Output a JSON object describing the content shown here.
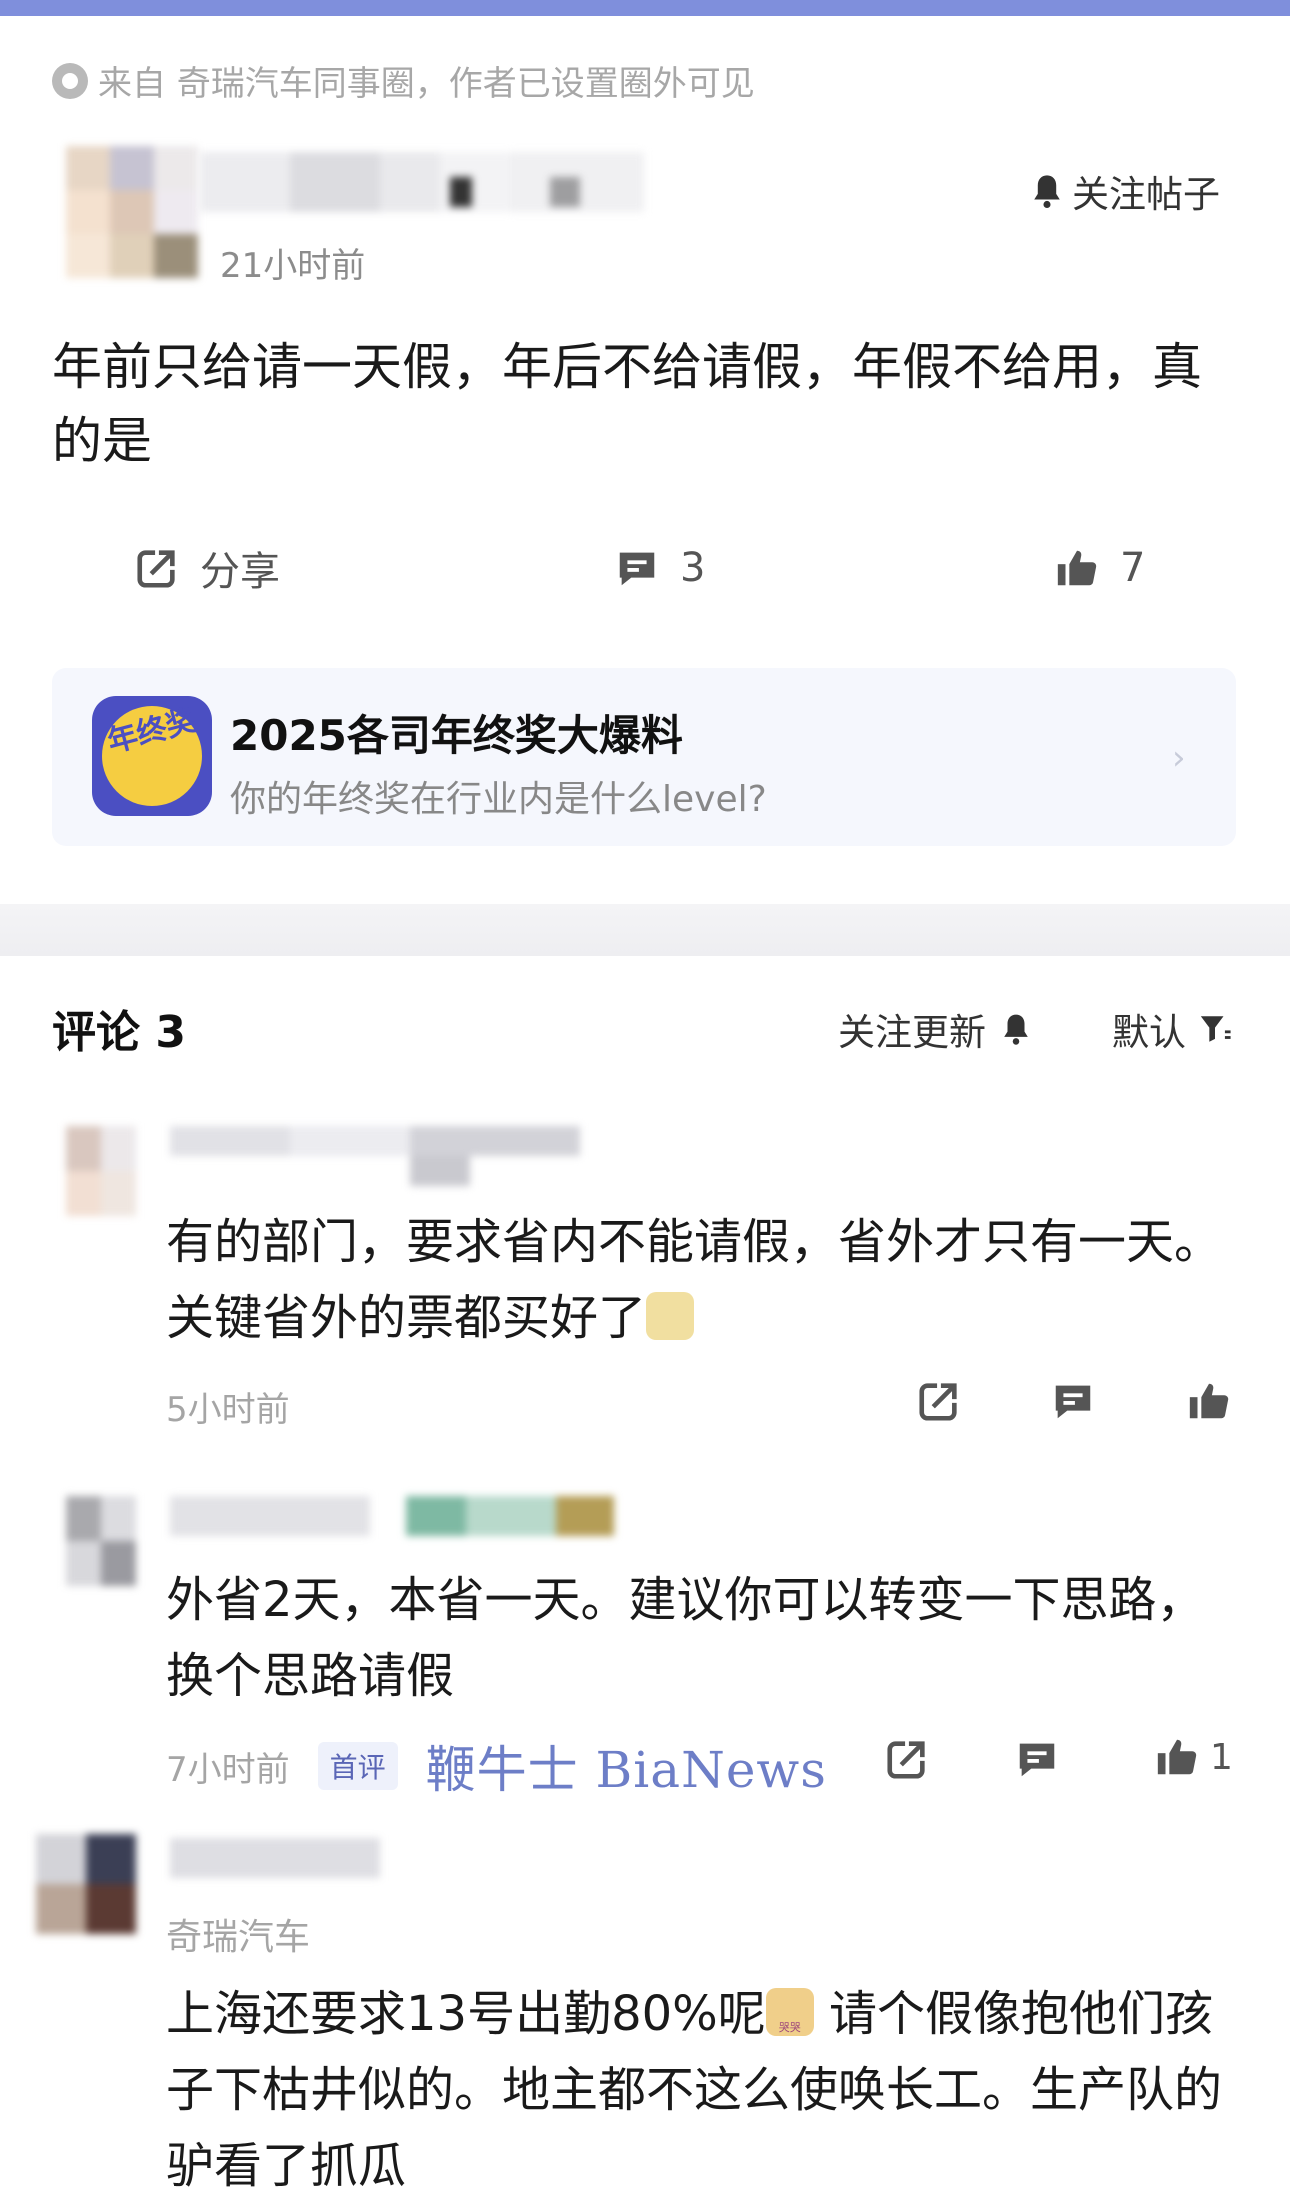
{
  "post": {
    "source_text": "来自 奇瑞汽车同事圈，作者已设置圈外可见",
    "time": "21小时前",
    "follow_label": "关注帖子",
    "body": "年前只给请一天假，年后不给请假，年假不给用，真的是",
    "share_label": "分享",
    "comment_count": "3",
    "like_count": "7"
  },
  "banner": {
    "logo_text": "年终奖",
    "title": "2025各司年终奖大爆料",
    "subtitle": "你的年终奖在行业内是什么level?"
  },
  "comments_header": {
    "title": "评论 3",
    "follow_updates": "关注更新",
    "sort_label": "默认"
  },
  "comments": [
    {
      "text": "有的部门，要求省内不能请假，省外才只有一天。关键省外的票都买好了",
      "time": "5小时前"
    },
    {
      "text": "外省2天，本省一天。建议你可以转变一下思路，换个思路请假",
      "time": "7小时前",
      "badge": "首评",
      "like_count": "1"
    },
    {
      "company": "奇瑞汽车",
      "text_part1": "上海还要求13号出勤80%呢",
      "text_part2": "请个假像抱他们孩子下枯井似的。地主都不这么使唤长工。生产队的驴看了抓瓜",
      "emoji_label": "哭哭"
    }
  ],
  "watermark": "鞭牛士 BiaNews",
  "colors": {
    "accent": "#7f8fdc",
    "watermark": "#6d7ec7",
    "banner_bg": "#f5f7fd"
  },
  "icons": [
    "eye-icon",
    "bell-icon",
    "share-icon",
    "comment-icon",
    "thumbs-up-icon",
    "filter-icon",
    "chevron-right-icon"
  ]
}
